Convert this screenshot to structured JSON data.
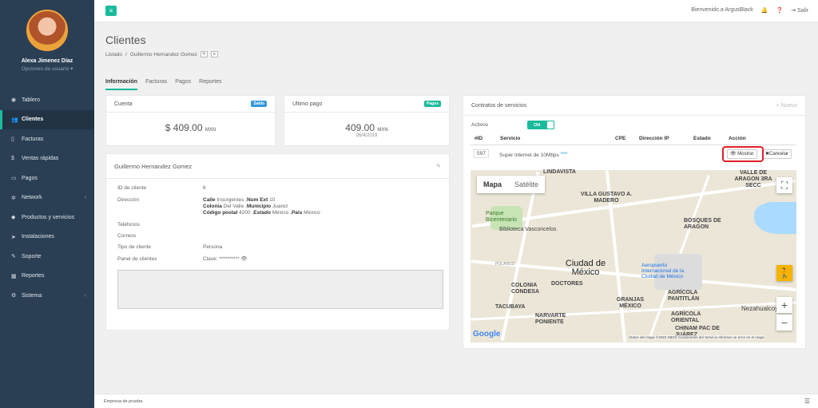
{
  "app": {
    "title": "Clientes"
  },
  "user": {
    "name": "Alexa Jimenez Díaz",
    "options": "Opciones de usuario"
  },
  "sidebar": {
    "items": [
      {
        "label": "Tablero",
        "icon": "dashboard-icon"
      },
      {
        "label": "Clientes",
        "icon": "users-icon"
      },
      {
        "label": "Facturas",
        "icon": "file-icon"
      },
      {
        "label": "Ventas rápidas",
        "icon": "dollar-icon"
      },
      {
        "label": "Pagos",
        "icon": "money-icon"
      },
      {
        "label": "Network",
        "icon": "network-icon"
      },
      {
        "label": "Productos y servicios",
        "icon": "tag-icon"
      },
      {
        "label": "Instalaciones",
        "icon": "location-icon"
      },
      {
        "label": "Soporte",
        "icon": "wrench-icon"
      },
      {
        "label": "Reportes",
        "icon": "chart-icon"
      },
      {
        "label": "Sistema",
        "icon": "cogs-icon"
      }
    ]
  },
  "header": {
    "welcome": "Bienvenido a ArgusBlack",
    "logout": "Salir"
  },
  "breadcrumb": {
    "root": "Listado",
    "current": "Guillermo Hernandez Gomez"
  },
  "tabs": [
    "Información",
    "Facturas",
    "Pagos",
    "Reportes"
  ],
  "cuenta": {
    "title": "Cuenta",
    "badge": "Saldo",
    "amount": "$ 409.00",
    "currency": "MXN"
  },
  "ultimo_pago": {
    "title": "Ultimo pago",
    "badge": "Pagos",
    "amount": "409.00",
    "currency": "MXN",
    "date": "26/4/2019"
  },
  "client": {
    "name": "Guillermo Hernandez Gomez",
    "id_label": "ID de cliente",
    "id": "6",
    "dir_label": "Dirección",
    "calle_label": "Calle",
    "calle": "Insurgentes",
    "num_label": "Num Ext",
    "num": "10",
    "colonia_label": "Colonia",
    "colonia": "Del Valle",
    "mun_label": "Municipio",
    "mun": "Juarez",
    "cp_label": "Código postal",
    "cp": "4200",
    "estado_label": "Estado",
    "estado": "México",
    "pais_label": "Pais",
    "pais": "México",
    "tel_label": "Teléfonos",
    "correos_label": "Correos",
    "tipo_label": "Tipo de cliente",
    "tipo": "Persona",
    "panel_label": "Panel de clientes",
    "clave": "Clave: **********"
  },
  "contratos": {
    "title": "Contratos de servicios",
    "new": "+ Nuevo",
    "activos": "Activos",
    "toggle": "ON",
    "headers": [
      "#ID",
      "Servicio",
      "CPE",
      "Dirección IP",
      "Estado",
      "Acción"
    ],
    "row": {
      "id": "597",
      "servicio": "Super internet de 10Mbps",
      "tag": "RMP",
      "mostrar": "Mostrar",
      "cancelar": "Cancelar"
    }
  },
  "map": {
    "tab_map": "Mapa",
    "tab_sat": "Satélite",
    "attrib": "Datos del mapa ©2020 INEGI   Condiciones del Servicio   Informar un error en el mapa",
    "google": "Google",
    "labels": [
      "LINDAVISTA",
      "VALLE DE ARAGON 3RA SECC",
      "VILLA GUSTAVO A. MADERO",
      "Parque Bicentenario",
      "Biblioteca Vasconcelos",
      "BOSQUES DE ARAGON",
      "Ciudad de México",
      "Aeropuerto Internacional de la Ciudad de México",
      "COLONIA CONDESA",
      "DOCTORES",
      "GRANJAS MÉXICO",
      "AGRÍCOLA PANTITLÁN",
      "TACUBAYA",
      "NARVARTE PONIENTE",
      "AGRÍCOLA ORIENTAL",
      "Nezahualcoy",
      "POLANCO",
      "CHINAM PAC DE JUÁREZ"
    ]
  },
  "footer": {
    "company": "Empresa de prueba"
  }
}
